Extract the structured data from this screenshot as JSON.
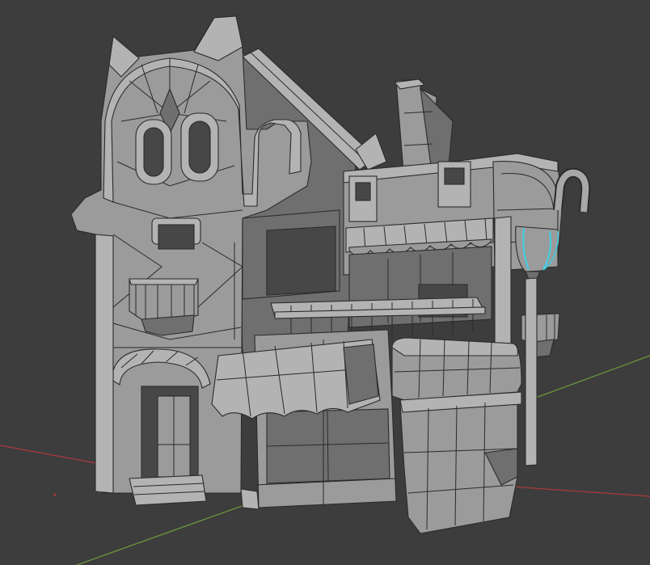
{
  "viewport": {
    "background": "#3d3d3d",
    "mesh_color": "#9b9b9b",
    "wire_color": "#2a2a2a",
    "selection_color": "#3fd0e6",
    "axis_x_color": "#b03a3a",
    "axis_y_color": "#6a9a3a"
  },
  "scene": {
    "object": "building-mesh",
    "selected_part": "hanging-lantern"
  }
}
